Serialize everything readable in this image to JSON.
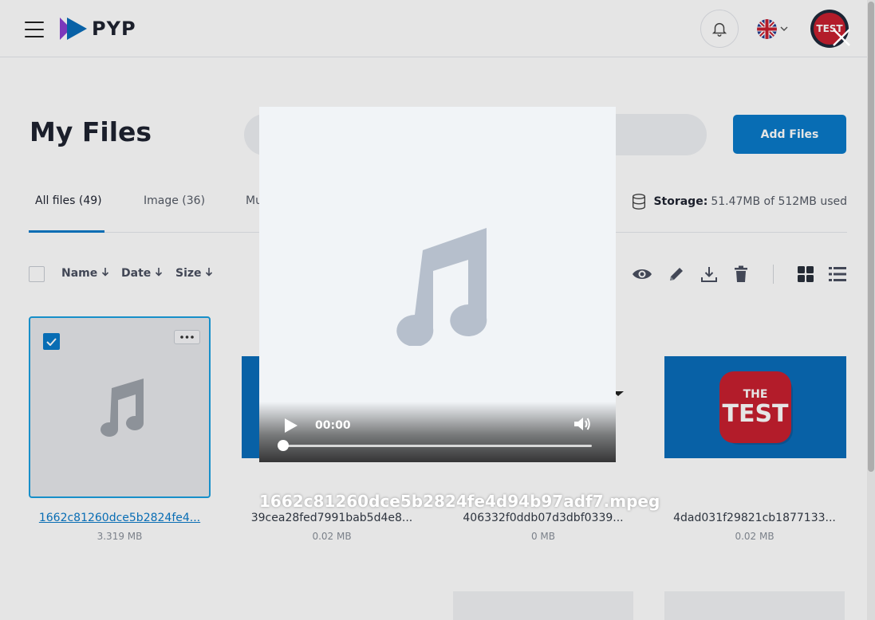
{
  "header": {
    "brand": "PYP",
    "avatar_text": "TEST"
  },
  "page": {
    "title": "My Files",
    "add_button": "Add Files"
  },
  "tabs": [
    {
      "label": "All files (49)",
      "active": true
    },
    {
      "label": "Image (36)",
      "active": false
    },
    {
      "label": "Mu",
      "active": false
    }
  ],
  "storage": {
    "label": "Storage:",
    "value": "51.47MB of 512MB used"
  },
  "sort": {
    "name": "Name",
    "date": "Date",
    "size": "Size"
  },
  "files": [
    {
      "name": "1662c81260dce5b2824fe4...",
      "size": "3.319 MB",
      "selected": true,
      "type": "audio"
    },
    {
      "name": "39cea28fed7991bab5d4e8...",
      "size": "0.02 MB",
      "selected": false,
      "type": "image"
    },
    {
      "name": "406332f0ddb07d3dbf0339...",
      "size": "0 MB",
      "selected": false,
      "type": "image"
    },
    {
      "name": "4dad031f29821cb1877133...",
      "size": "0.02 MB",
      "selected": false,
      "type": "image"
    }
  ],
  "player": {
    "time": "00:00",
    "progress": 0,
    "caption": "1662c81260dce5b2824fe4d94b97adf7.mpeg"
  },
  "colors": {
    "accent": "#0a7ac9",
    "brand_blue": "#0a6db9",
    "test_red": "#c8202f"
  },
  "icons": [
    "menu-icon",
    "notification-bell-icon",
    "uk-flag-icon",
    "chevron-down-icon",
    "database-icon",
    "arrow-down-icon",
    "eye-icon",
    "pencil-icon",
    "download-icon",
    "trash-icon",
    "grid-view-icon",
    "list-view-icon",
    "checkmark-icon",
    "more-dots-icon",
    "music-note-icon",
    "play-icon",
    "volume-icon",
    "close-icon"
  ]
}
